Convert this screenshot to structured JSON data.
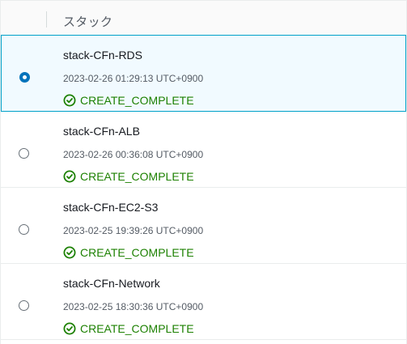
{
  "header": {
    "title": "スタック"
  },
  "stacks": [
    {
      "name": "stack-CFn-RDS",
      "created": "2023-02-26 01:29:13 UTC+0900",
      "status": "CREATE_COMPLETE",
      "selected": true
    },
    {
      "name": "stack-CFn-ALB",
      "created": "2023-02-26 00:36:08 UTC+0900",
      "status": "CREATE_COMPLETE",
      "selected": false
    },
    {
      "name": "stack-CFn-EC2-S3",
      "created": "2023-02-25 19:39:26 UTC+0900",
      "status": "CREATE_COMPLETE",
      "selected": false
    },
    {
      "name": "stack-CFn-Network",
      "created": "2023-02-25 18:30:36 UTC+0900",
      "status": "CREATE_COMPLETE",
      "selected": false
    }
  ],
  "icons": {
    "status_icon": "check-circle-icon"
  },
  "colors": {
    "accent": "#0073bb",
    "selected_border": "#00a1c9",
    "selected_bg": "#f1faff",
    "status_success": "#1d8102"
  }
}
